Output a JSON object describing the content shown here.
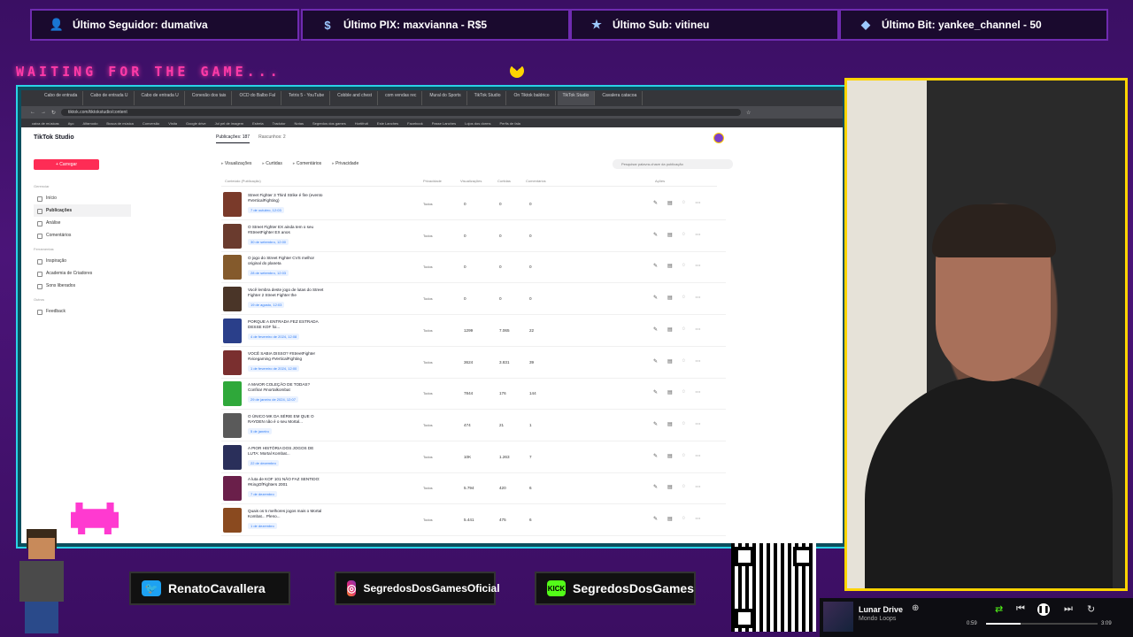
{
  "overlay": {
    "alerts": [
      {
        "icon": "user-icon",
        "text": "Último Seguidor: dumativa"
      },
      {
        "icon": "dollar-icon",
        "text": "Último PIX: maxvianna - R$5"
      },
      {
        "icon": "star-icon",
        "text": "Último Sub: vitineu"
      },
      {
        "icon": "diamond-icon",
        "text": "Último Bit: yankee_channel - 50"
      }
    ],
    "waiting": "WAITING FOR THE GAME...",
    "social": [
      {
        "icon": "twitter-icon",
        "text": "RenatoCavallera"
      },
      {
        "icon": "instagram-icon",
        "text": "SegredosDosGamesOficial"
      },
      {
        "icon": "kick-icon",
        "badge": "KICK",
        "text": "SegredosDosGames"
      }
    ],
    "qr_url": "livepix.gg/segredosdosgames",
    "player": {
      "song": "Lunar Drive",
      "artist": "Mondo Loops",
      "elapsed": "0:59",
      "total": "3:09",
      "progress": 0.31
    }
  },
  "browser": {
    "tabs": [
      "Cabo de entrada",
      "Cabo de entrada U",
      "Cabo de entrada U",
      "Conexão dos tais",
      "OCD do Balbo Fal",
      "Tetris 5 - YouTube",
      "Cobble and chest",
      "com vendas rec",
      "Mural do Sports",
      "TikTok Studio",
      "On Tiktok baldrico",
      "TikTok Studio",
      "Cavalera catacoa"
    ],
    "active_tab": 11,
    "url": "tiktok.com/tiktokstudio/content",
    "bookmarks": [
      "caixa de músicas",
      "Ayo",
      "Alfamodo",
      "Busca de música",
      "Conversão",
      "Visita",
      "Google drive",
      "Jul pel de imagem",
      "Estrela",
      "Tradutor",
      "Notas",
      "Segredos dos games",
      "Hortifruti",
      "Este Lanches",
      "Facebook",
      "Passe Lanches",
      "Lojos dos dorms",
      "Perfis de fala"
    ]
  },
  "studio": {
    "logo": "TikTok Studio",
    "upload": "+ Carregar",
    "nav_sections": [
      {
        "title": "Gerenciar",
        "items": [
          {
            "label": "Início"
          },
          {
            "label": "Publicações",
            "active": true
          },
          {
            "label": "Análise"
          },
          {
            "label": "Comentários"
          }
        ]
      },
      {
        "title": "Ferramentas",
        "items": [
          {
            "label": "Inspiração"
          },
          {
            "label": "Academia de Criadores"
          },
          {
            "label": "Sons liberados"
          }
        ]
      },
      {
        "title": "Outros",
        "items": [
          {
            "label": "Feedback"
          }
        ]
      }
    ],
    "tabs": [
      "Publicações: 187",
      "Rascunhos: 2"
    ],
    "filters": [
      "Visualizações",
      "Curtidas",
      "Comentários",
      "Privacidade"
    ],
    "search_placeholder": "Pesquisar palavra-chave da publicação",
    "columns": [
      "Conteúdo (Publicação)",
      "Privacidade",
      "Visualizações",
      "Curtidas",
      "Comentários",
      "Ações"
    ],
    "rows": [
      {
        "title": "Street Fighter 3 Third Strike é fire (evento #VerticalFighting)",
        "date": "7 de outubro, 12:03",
        "privacy": "Todos",
        "views": "0",
        "likes": "0",
        "comments": "0",
        "thumb": "#7a3a2a"
      },
      {
        "title": "O Street Fighter EX ainda tem o seu #StreetFighter EX anos",
        "date": "30 de setembro, 12:00",
        "privacy": "Todos",
        "views": "0",
        "likes": "0",
        "comments": "0",
        "thumb": "#6a3b2e"
      },
      {
        "title": "O jogo do Street Fighter CVS melhor original do planeta",
        "date": "28 de setembro, 12:03",
        "privacy": "Todos",
        "views": "0",
        "likes": "0",
        "comments": "0",
        "thumb": "#845a2c"
      },
      {
        "title": "Você lembra deste jogo de lutas do Street Fighter 2 Street Fighter the",
        "date": "19 de agosto, 12:03",
        "privacy": "Todos",
        "views": "0",
        "likes": "0",
        "comments": "0",
        "thumb": "#4a3528"
      },
      {
        "title": "PORQUE A ENTRADA FEZ ESTRADA DESSE KOF foi...",
        "date": "4 de fevereiro de 2024, 12:08",
        "privacy": "Todos",
        "views": "1299",
        "likes": "7.065",
        "comments": "22",
        "thumb": "#2a3f8a"
      },
      {
        "title": "VOCÊ SABIA DISSO? #StreetFighter #vicegaming #VerticalFighting",
        "date": "1 de fevereiro de 2024, 12:00",
        "privacy": "Todos",
        "views": "3624",
        "likes": "3.831",
        "comments": "39",
        "thumb": "#7a2f2f"
      },
      {
        "title": "A MAIOR COLEÇÃO DE TODAS? Confira! #mortalkombat",
        "date": "29 de janeiro de 2024, 12:07",
        "privacy": "Todos",
        "views": "7844",
        "likes": "176",
        "comments": "144",
        "thumb": "#2fa83a"
      },
      {
        "title": "O ÚNICO MK DA SÉRIE EM QUE O RAYDEN não é o seu Mortal...",
        "date": "5 de janeiro",
        "privacy": "Todos",
        "views": "474",
        "likes": "21",
        "comments": "1",
        "thumb": "#5a5a5a"
      },
      {
        "title": "A PIOR HISTÓRIA DOS JOGOS DE LUTA: Mortal Kombat...",
        "date": "22 de dezembro",
        "privacy": "Todos",
        "views": "10K",
        "likes": "1.263",
        "comments": "7",
        "thumb": "#2a2f5a"
      },
      {
        "title": "A luta de KOF 101 NÃO FAZ SENTIDO: #KingOfFighters 2001",
        "date": "7 de dezembro",
        "privacy": "Todos",
        "views": "5.794",
        "likes": "420",
        "comments": "6",
        "thumb": "#6a1f4a"
      },
      {
        "title": "Quais os 5 melhores jogos mais o Mortal Kombat... Pleno...",
        "date": "1 de dezembro",
        "privacy": "Todos",
        "views": "5.441",
        "likes": "475",
        "comments": "6",
        "thumb": "#8a4a1f"
      }
    ]
  }
}
